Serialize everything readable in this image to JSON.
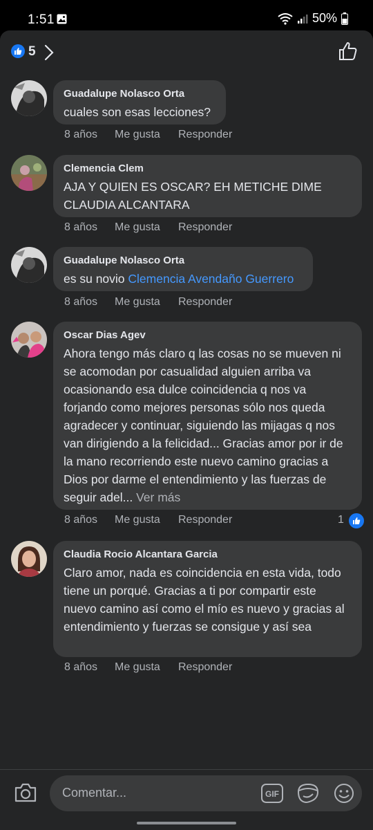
{
  "status_bar": {
    "time": "1:51",
    "battery": "50%"
  },
  "header": {
    "reaction_count": "5"
  },
  "comments": [
    {
      "author": "Guadalupe Nolasco Orta",
      "text": "cuales son esas lecciones?",
      "age": "8 años",
      "like_label": "Me gusta",
      "reply_label": "Responder"
    },
    {
      "author": "Clemencia Clem",
      "text": "AJA Y QUIEN ES OSCAR? EH METICHE DIME CLAUDIA ALCANTARA",
      "age": "8 años",
      "like_label": "Me gusta",
      "reply_label": "Responder"
    },
    {
      "author": "Guadalupe Nolasco Orta",
      "text": "es su novio ",
      "mention": "Clemencia Avendaño Guerrero",
      "age": "8 años",
      "like_label": "Me gusta",
      "reply_label": "Responder"
    },
    {
      "author": "Oscar Dias Agev",
      "text": "Ahora tengo más claro q las cosas no se mueven ni se acomodan por casualidad alguien arriba va ocasionando esa dulce coincidencia q nos va forjando como mejores personas sólo nos queda agradecer y continuar, siguiendo las mijagas q nos van dirigiendo a la felicidad... Gracias amor por ir de la mano recorriendo este nuevo camino gracias a Dios por darme el entendimiento y las fuerzas de seguir adel... ",
      "see_more": "Ver más",
      "age": "8 años",
      "like_label": "Me gusta",
      "reply_label": "Responder",
      "reactions": "1"
    },
    {
      "author": "Claudia Rocio Alcantara Garcia",
      "text": "Claro amor, nada es coincidencia en esta vida, todo tiene un porqué.  Gracias a ti por compartir este nuevo camino así como el mío es nuevo y gracias al entendimiento y fuerzas se consigue y así sea",
      "age": "8 años",
      "like_label": "Me gusta",
      "reply_label": "Responder"
    }
  ],
  "composer": {
    "placeholder": "Comentar...",
    "gif_label": "GIF"
  },
  "colors": {
    "sheet_bg": "#242526",
    "bubble_bg": "#3a3b3c",
    "accent": "#1877f2",
    "mention": "#4599ff"
  }
}
